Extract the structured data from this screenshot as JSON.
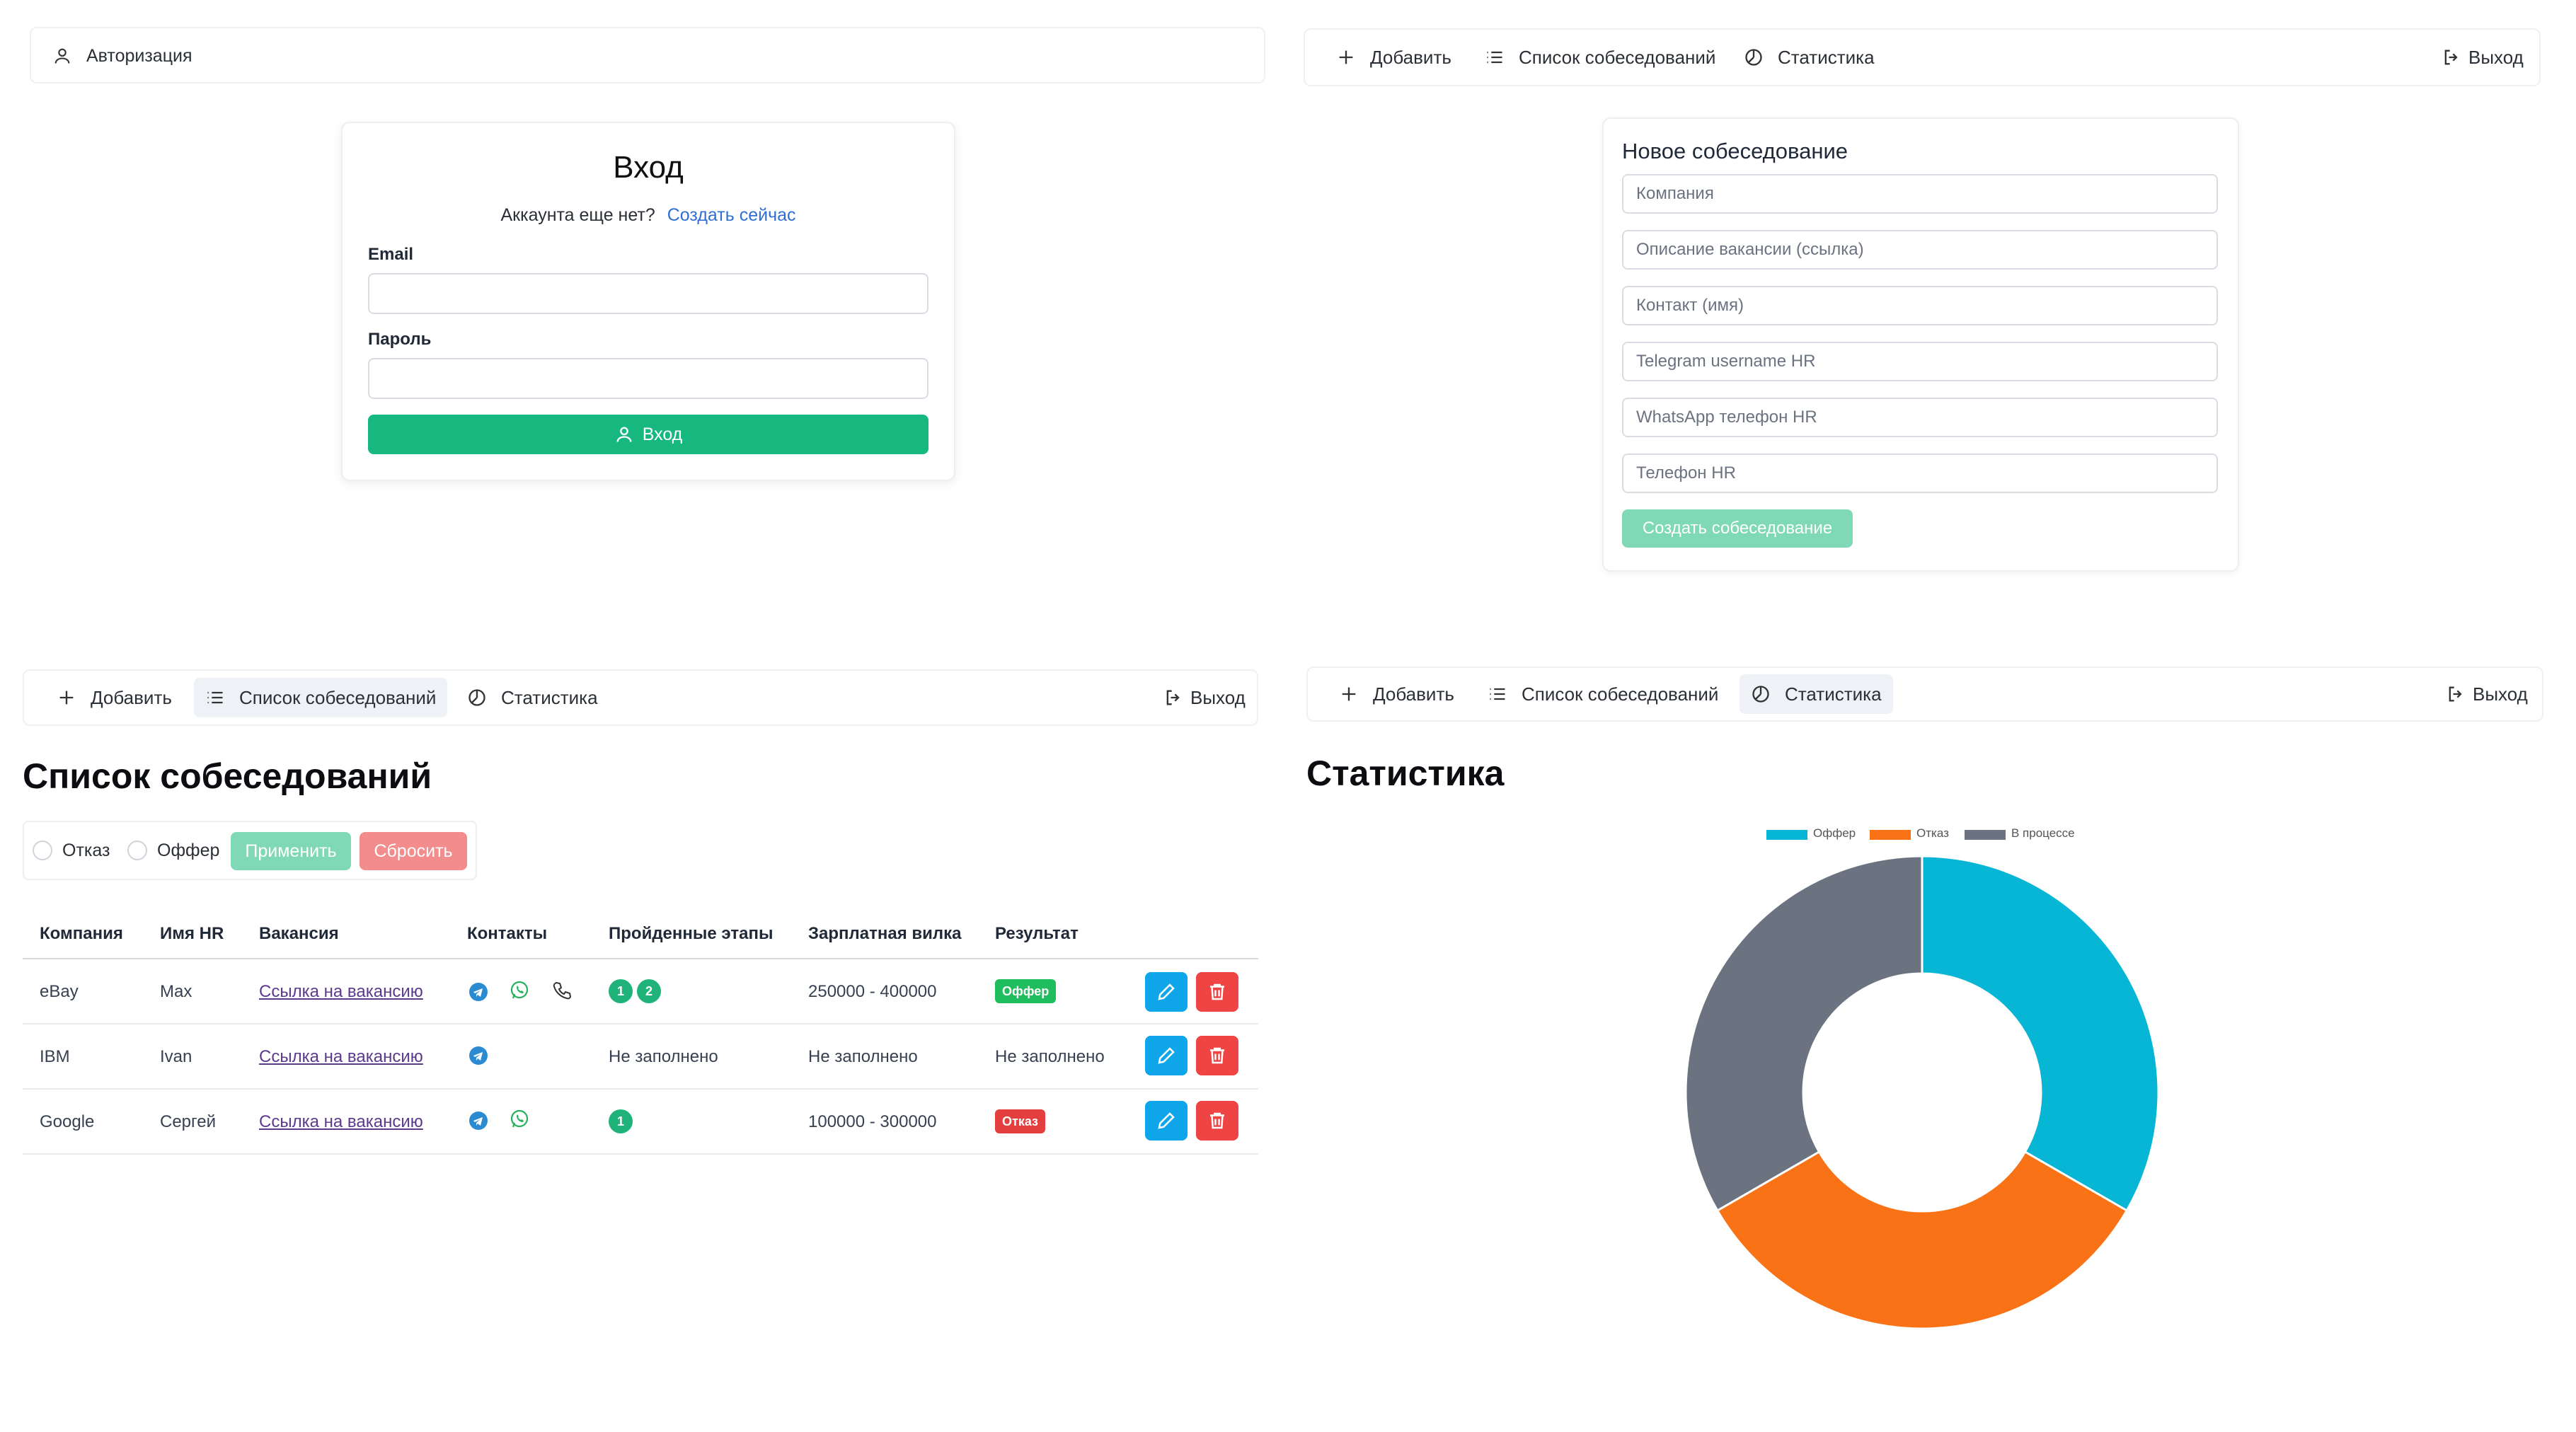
{
  "auth_panel": {
    "nav_label": "Авторизация",
    "card": {
      "title": "Вход",
      "no_account_text": "Аккаунта еще нет?",
      "create_link": "Создать сейчас",
      "email_label": "Email",
      "email_value": "",
      "password_label": "Пароль",
      "password_value": "",
      "submit_label": "Вход"
    }
  },
  "nav": {
    "add": "Добавить",
    "list": "Список собеседований",
    "stats": "Статистика",
    "logout": "Выход"
  },
  "new_interview_panel": {
    "title": "Новое собеседование",
    "placeholders": {
      "company": "Компания",
      "vacancy": "Описание вакансии (ссылка)",
      "contact": "Контакт (имя)",
      "telegram": "Telegram username HR",
      "whatsapp": "WhatsApp телефон HR",
      "phone": "Телефон HR"
    },
    "submit_label": "Создать собеседование"
  },
  "list_panel": {
    "title": "Список собеседований",
    "filters": {
      "refusal": "Отказ",
      "offer": "Оффер",
      "apply": "Применить",
      "reset": "Сбросить"
    },
    "columns": [
      "Компания",
      "Имя HR",
      "Вакансия",
      "Контакты",
      "Пройденные этапы",
      "Зарплатная вилка",
      "Результат"
    ],
    "rows": [
      {
        "company": "eBay",
        "hr": "Max",
        "vacancy": "Ссылка на вакансию",
        "contacts": [
          "telegram-icon",
          "whatsapp-icon",
          "phone-icon"
        ],
        "stages": [
          "1",
          "2"
        ],
        "stages_text": "",
        "salary": "250000 - 400000",
        "result": "Оффер",
        "result_type": "offer"
      },
      {
        "company": "IBM",
        "hr": "Ivan",
        "vacancy": "Ссылка на вакансию",
        "contacts": [
          "telegram-icon"
        ],
        "stages": [],
        "stages_text": "Не заполнено",
        "salary": "Не заполнено",
        "result": "Не заполнено",
        "result_type": "none"
      },
      {
        "company": "Google",
        "hr": "Сергей",
        "vacancy": "Ссылка на вакансию",
        "contacts": [
          "telegram-icon",
          "whatsapp-icon"
        ],
        "stages": [
          "1"
        ],
        "stages_text": "",
        "salary": "100000 - 300000",
        "result": "Отказ",
        "result_type": "refusal"
      }
    ]
  },
  "stats_panel": {
    "title": "Статистика"
  },
  "colors": {
    "primary_green": "#17b880",
    "light_green": "#7fd9b6",
    "light_red": "#f38c8c",
    "offer_badge": "#1fbd5d",
    "refusal_badge": "#e53e3e",
    "edit_button": "#0ea5e9",
    "delete_button": "#ef4444",
    "link_blue": "#2f6fd1"
  },
  "chart_data": {
    "type": "pie",
    "donut": true,
    "legend_position": "top",
    "categories": [
      "Оффер",
      "Отказ",
      "В процессе"
    ],
    "values": [
      1,
      1,
      1
    ],
    "colors": [
      "#06b6d4",
      "#f97316",
      "#6b7280"
    ]
  }
}
